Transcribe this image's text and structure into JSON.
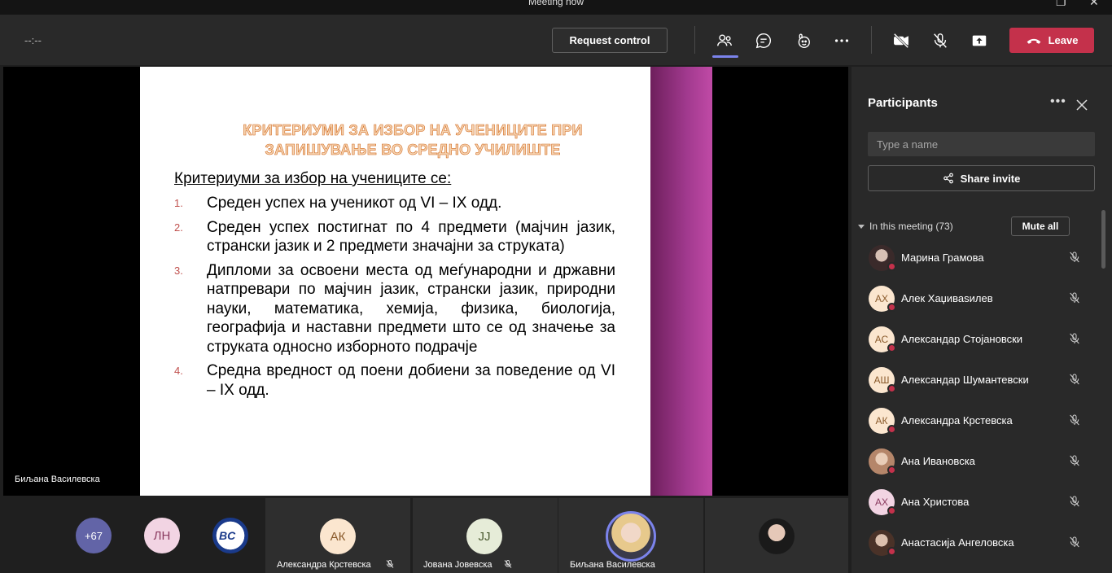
{
  "window": {
    "title": "Meeting now"
  },
  "toolbar": {
    "timer": "--:--",
    "request_control": "Request control",
    "leave": "Leave"
  },
  "slide": {
    "title_line1": "КРИТЕРИУМИ ЗА ИЗБОР НА УЧЕНИЦИТЕ ПРИ",
    "title_line2": "ЗАПИШУВАЊЕ  ВО СРЕДНО УЧИЛИШТЕ",
    "subtitle": "Критериуми за избор на учениците се:",
    "items": [
      {
        "num": "1.",
        "text": "Среден успех на ученикот од VI – IX одд."
      },
      {
        "num": "2.",
        "text": "Среден успех постигнат по 4 предмети (мајчин јазик, странски јазик и 2 предмети значајни за струката)"
      },
      {
        "num": "3.",
        "text": "Дипломи за освоени места од меѓународни и државни натпревари по мајчин јазик, странски јазик,  природни науки, математика, хемија, физика, биологија, географија и наставни предмети што се од значење за струката односно изборното подрачје"
      },
      {
        "num": "4.",
        "text": "Средна вредност од поени добиени за поведение од VI – IX одд."
      }
    ]
  },
  "stage": {
    "presenter_name": "Биљана Василевска"
  },
  "bottom": {
    "more_count": "+67",
    "avatar_ln": "ЛН",
    "tiles": [
      {
        "initials": "АК",
        "name": "Александра Крстевска"
      },
      {
        "initials": "JJ",
        "name": "Јована Јовевска"
      },
      {
        "initials": "",
        "name": "Биљана Василевска"
      }
    ]
  },
  "panel": {
    "title": "Participants",
    "search_placeholder": "Type a name",
    "share_invite": "Share invite",
    "section_label": "In this meeting (73)",
    "mute_all": "Mute all",
    "participants": [
      {
        "initials": "",
        "name": "Марина Грамова"
      },
      {
        "initials": "АХ",
        "name": "Алек Хаџиваsилев"
      },
      {
        "initials": "АС",
        "name": "Александар Стојановски"
      },
      {
        "initials": "АШ",
        "name": "Александар Шумантевски"
      },
      {
        "initials": "АК",
        "name": "Александра Крстевска"
      },
      {
        "initials": "",
        "name": "Ана Ивановска"
      },
      {
        "initials": "АХ",
        "name": "Ана Христова"
      },
      {
        "initials": "",
        "name": "Анастасија Ангеловска"
      }
    ]
  },
  "colors": {
    "leave": "#c4314b",
    "accent": "#7b83eb",
    "slide_band": "#a23a8f"
  },
  "icons": [
    "people-icon",
    "chat-icon",
    "reactions-icon",
    "more-icon",
    "camera-off-icon",
    "mic-off-icon",
    "share-tray-icon",
    "phone-icon",
    "close-icon",
    "share-icon"
  ]
}
